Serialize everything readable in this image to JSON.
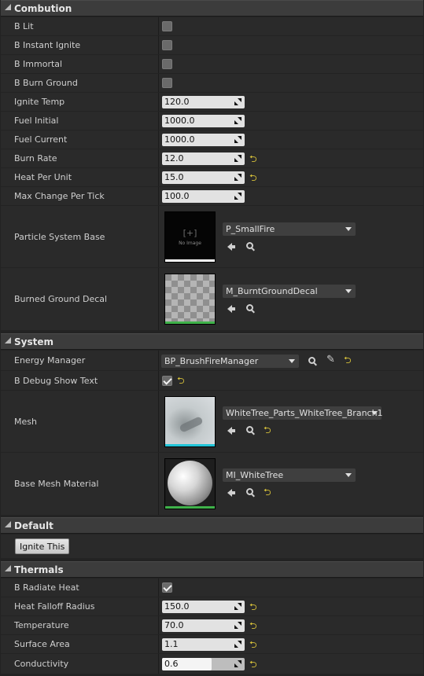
{
  "categories": {
    "combution": "Combution",
    "system": "System",
    "default": "Default",
    "thermals": "Thermals"
  },
  "combution": {
    "b_lit": {
      "label": "B Lit",
      "checked": false
    },
    "b_instant_ignite": {
      "label": "B Instant Ignite",
      "checked": false
    },
    "b_immortal": {
      "label": "B Immortal",
      "checked": false
    },
    "b_burn_ground": {
      "label": "B Burn Ground",
      "checked": false
    },
    "ignite_temp": {
      "label": "Ignite Temp",
      "value": "120.0"
    },
    "fuel_initial": {
      "label": "Fuel Initial",
      "value": "1000.0"
    },
    "fuel_current": {
      "label": "Fuel Current",
      "value": "1000.0"
    },
    "burn_rate": {
      "label": "Burn Rate",
      "value": "12.0"
    },
    "heat_per_unit": {
      "label": "Heat Per Unit",
      "value": "15.0"
    },
    "max_change_per_tick": {
      "label": "Max Change Per Tick",
      "value": "100.0"
    },
    "particle_system_base": {
      "label": "Particle System Base",
      "asset": "P_SmallFire",
      "thumb_text": "No Image",
      "thumb_glyph": "[+]"
    },
    "burned_ground_decal": {
      "label": "Burned Ground Decal",
      "asset": "M_BurntGroundDecal"
    }
  },
  "system": {
    "energy_manager": {
      "label": "Energy Manager",
      "value": "BP_BrushFireManager"
    },
    "b_debug_show_text": {
      "label": "B Debug Show Text",
      "checked": true
    },
    "mesh": {
      "label": "Mesh",
      "asset": "WhiteTree_Parts_WhiteTree_Branch1"
    },
    "base_mesh_material": {
      "label": "Base Mesh Material",
      "asset": "MI_WhiteTree"
    }
  },
  "default": {
    "ignite_button": "Ignite This"
  },
  "thermals": {
    "b_radiate_heat": {
      "label": "B Radiate Heat",
      "checked": true
    },
    "heat_falloff_radius": {
      "label": "Heat Falloff Radius",
      "value": "150.0"
    },
    "temperature": {
      "label": "Temperature",
      "value": "70.0"
    },
    "surface_area": {
      "label": "Surface Area",
      "value": "1.1"
    },
    "conductivity": {
      "label": "Conductivity",
      "value": "0.6",
      "slider_fraction": 0.6
    }
  },
  "icons": {
    "reset": "reset-to-default-icon",
    "browse": "search-icon",
    "use_selected": "arrow-left-icon",
    "picker": "eyedropper-icon"
  },
  "colors": {
    "header_bg": "#3c3c3c",
    "row_bg": "#2a2a2a",
    "reset_yellow": "#d8c23a",
    "mesh_underline": "#22c5d8",
    "material_underline": "#3fb24a",
    "particle_underline": "#ffffff"
  }
}
